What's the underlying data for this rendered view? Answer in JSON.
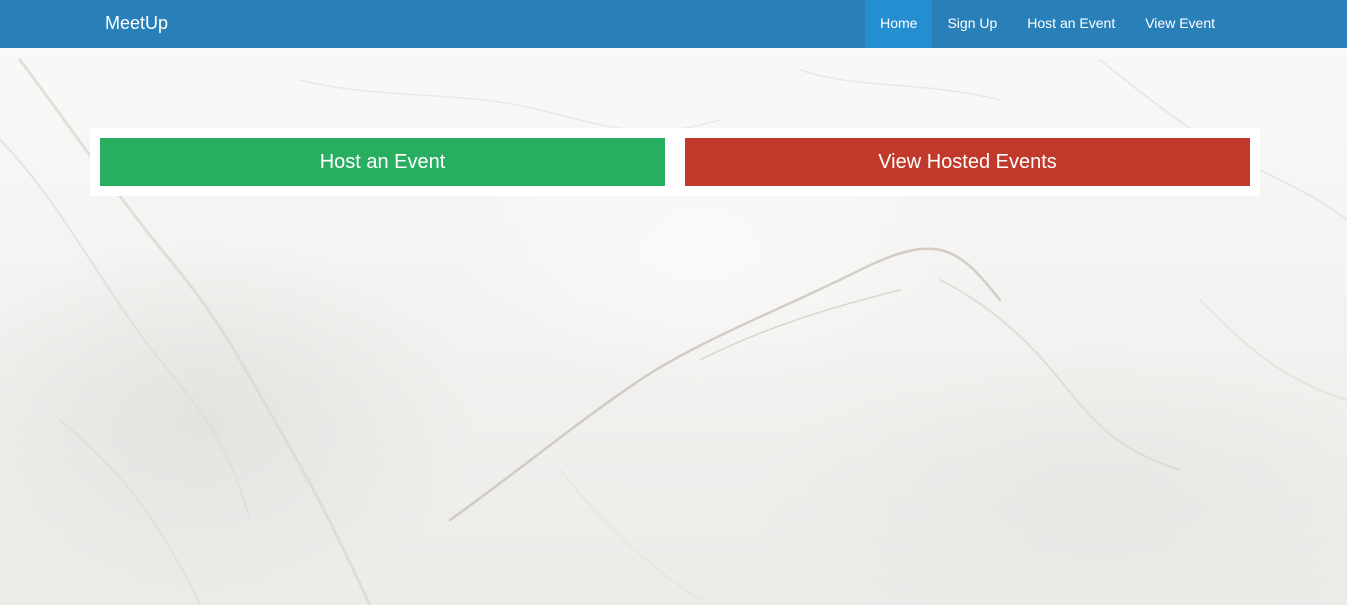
{
  "navbar": {
    "brand": "MeetUp",
    "items": [
      {
        "label": "Home",
        "active": true
      },
      {
        "label": "Sign Up",
        "active": false
      },
      {
        "label": "Host an Event",
        "active": false
      },
      {
        "label": "View Event",
        "active": false
      }
    ],
    "color": "#2980b9",
    "active_color": "#238fd0"
  },
  "actions": {
    "host_label": "Host an Event",
    "host_color": "#27ae60",
    "view_label": "View Hosted Events",
    "view_color": "#c0392b"
  }
}
